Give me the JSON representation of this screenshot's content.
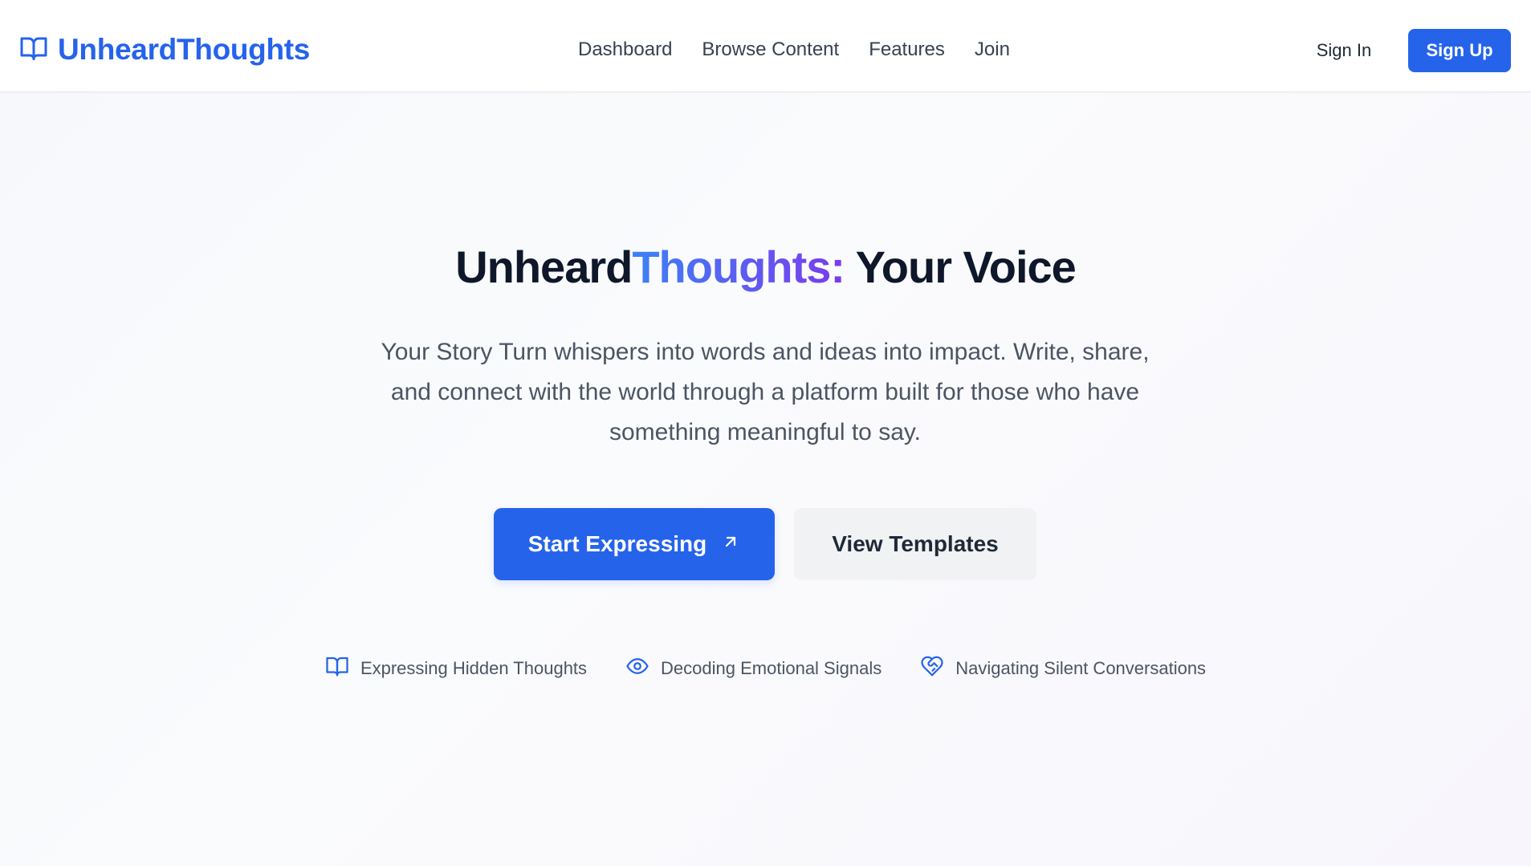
{
  "header": {
    "logo_text": "UnheardThoughts",
    "logo_icon": "book-open-icon",
    "nav": [
      {
        "label": "Dashboard"
      },
      {
        "label": "Browse Content"
      },
      {
        "label": "Features"
      },
      {
        "label": "Join"
      }
    ],
    "signin_label": "Sign In",
    "signup_label": "Sign Up"
  },
  "hero": {
    "title_part1": "Unheard",
    "title_accent": "Thoughts:",
    "title_part2": " Your Voice",
    "subtitle": "Your Story Turn whispers into words and ideas into impact. Write, share, and connect with the world through a platform built for those who have something meaningful to say.",
    "primary_cta": "Start Expressing",
    "primary_cta_icon": "arrow-up-right-icon",
    "secondary_cta": "View Templates"
  },
  "features": [
    {
      "icon": "book-open-icon",
      "label": "Expressing Hidden Thoughts"
    },
    {
      "icon": "eye-icon",
      "label": "Decoding Emotional Signals"
    },
    {
      "icon": "heart-handshake-icon",
      "label": "Navigating Silent Conversations"
    }
  ],
  "colors": {
    "brand": "#2563eb",
    "accent_gradient_start": "#3b82f6",
    "accent_gradient_end": "#7c3aed",
    "text_dark": "#0f172a",
    "text_muted": "#4b5563"
  }
}
